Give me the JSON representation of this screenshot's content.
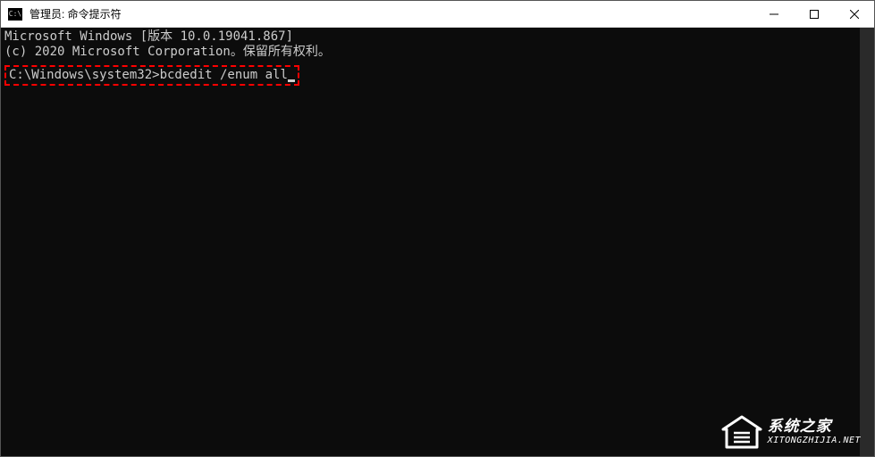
{
  "titlebar": {
    "icon_label": "C:\\",
    "title": "管理员: 命令提示符"
  },
  "terminal": {
    "line1": "Microsoft Windows [版本 10.0.19041.867]",
    "line2": "(c) 2020 Microsoft Corporation。保留所有权利。",
    "prompt": "C:\\Windows\\system32>",
    "command": "bcdedit /enum all"
  },
  "watermark": {
    "name": "系统之家",
    "url": "XITONGZHIJIA.NET"
  }
}
